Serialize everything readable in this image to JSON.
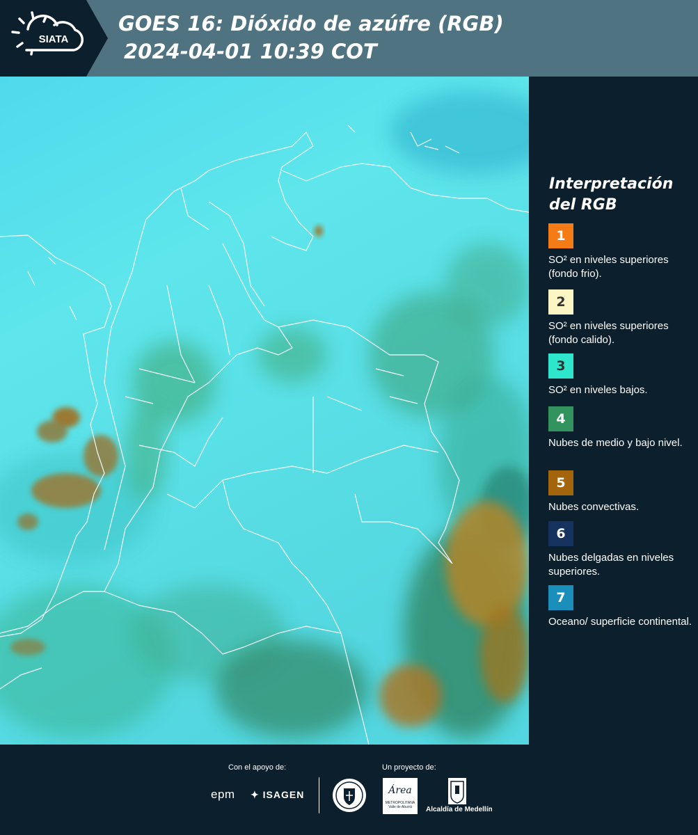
{
  "header": {
    "logo_text": "SIATA",
    "title_line1": "GOES 16: Dióxido de azúfre (RGB)",
    "title_line2": "2024-04-01 10:39 COT",
    "logo_icon": "sun-cloud-icon"
  },
  "legend": {
    "title_line1": "Interpretación",
    "title_line2": "del RGB",
    "items": [
      {
        "number": "1",
        "color": "#f57b16",
        "text_color": "#ffffff",
        "label": "SO² en niveles superiores (fondo frio)."
      },
      {
        "number": "2",
        "color": "#fcf6c4",
        "text_color": "#333333",
        "label": "SO² en niveles superiores (fondo calido)."
      },
      {
        "number": "3",
        "color": "#2ee6cb",
        "text_color": "#333333",
        "label": "SO² en niveles bajos."
      },
      {
        "number": "4",
        "color": "#33935f",
        "text_color": "#ffffff",
        "label": "Nubes de medio y bajo nivel."
      },
      {
        "number": "5",
        "color": "#a3640c",
        "text_color": "#ffffff",
        "label": "Nubes convectivas."
      },
      {
        "number": "6",
        "color": "#15335e",
        "text_color": "#ffffff",
        "label": "Nubes delgadas en niveles superiores."
      },
      {
        "number": "7",
        "color": "#1b8fbb",
        "text_color": "#ffffff",
        "label": "Oceano/ superficie continental."
      }
    ]
  },
  "footer": {
    "support_label": "Con el apoyo de:",
    "project_label": "Un proyecto de:",
    "epm": "epm",
    "isagen": "ISAGEN",
    "area_script": "Área",
    "area_line1": "METROPOLITANA",
    "area_line2": "Valle de Aburrá",
    "alcaldia": "Alcaldía de Medellín"
  }
}
